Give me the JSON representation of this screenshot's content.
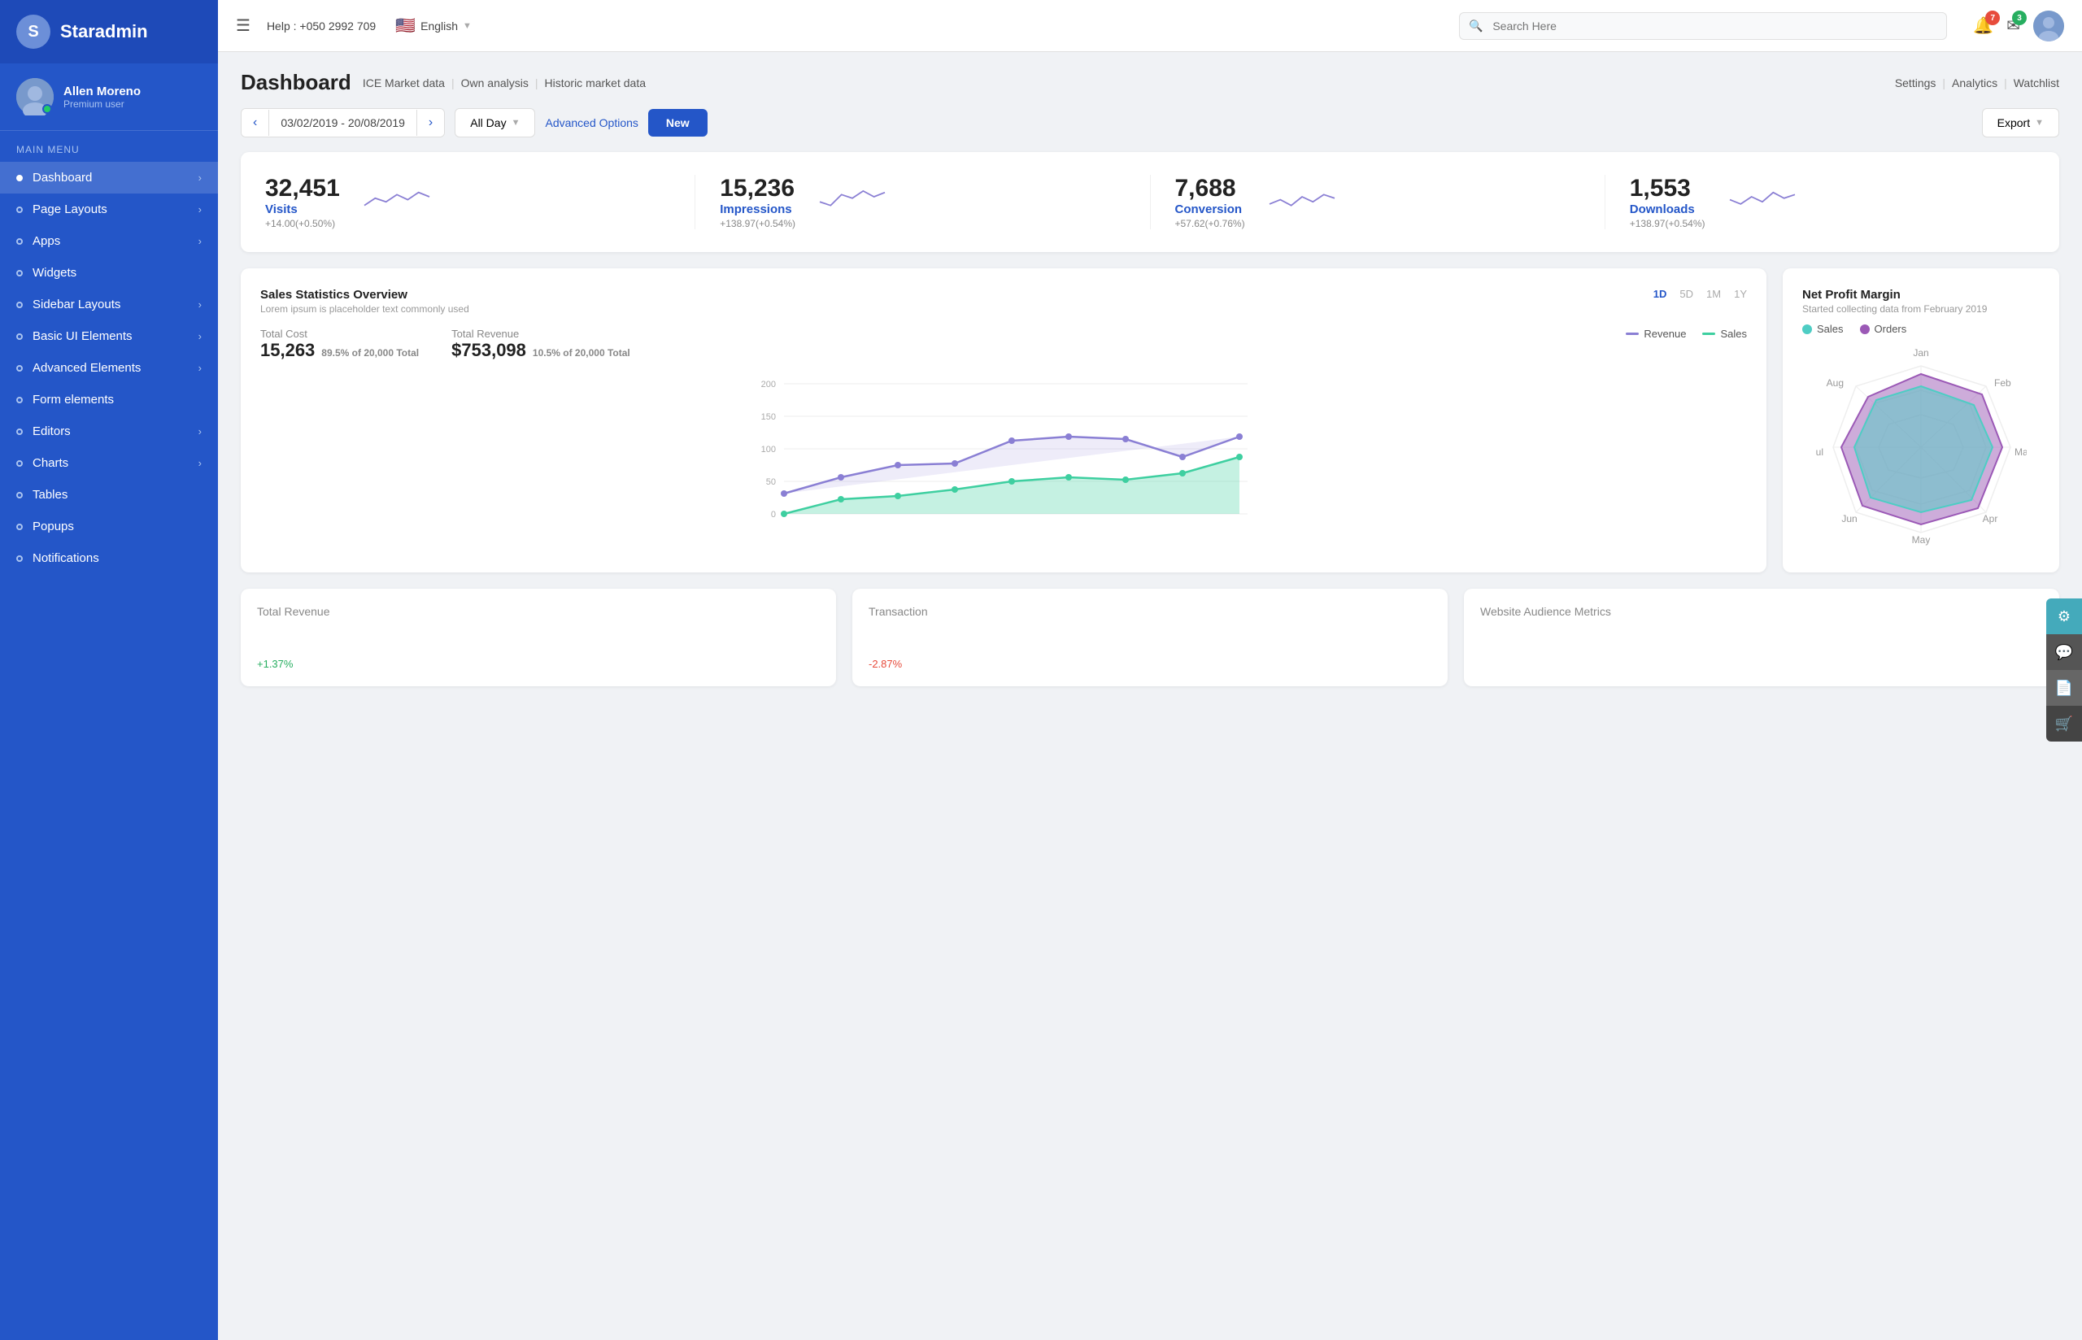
{
  "sidebar": {
    "logo_initial": "S",
    "logo_text": "Staradmin",
    "user_name": "Allen Moreno",
    "user_role": "Premium user",
    "main_menu_label": "Main Menu",
    "items": [
      {
        "label": "Dashboard",
        "has_arrow": true,
        "active": true
      },
      {
        "label": "Page Layouts",
        "has_arrow": true,
        "active": false
      },
      {
        "label": "Apps",
        "has_arrow": true,
        "active": false
      },
      {
        "label": "Widgets",
        "has_arrow": false,
        "active": false
      },
      {
        "label": "Sidebar Layouts",
        "has_arrow": true,
        "active": false
      },
      {
        "label": "Basic UI Elements",
        "has_arrow": true,
        "active": false
      },
      {
        "label": "Advanced Elements",
        "has_arrow": true,
        "active": false
      },
      {
        "label": "Form elements",
        "has_arrow": false,
        "active": false
      },
      {
        "label": "Editors",
        "has_arrow": true,
        "active": false
      },
      {
        "label": "Charts",
        "has_arrow": true,
        "active": false
      },
      {
        "label": "Tables",
        "has_arrow": false,
        "active": false
      },
      {
        "label": "Popups",
        "has_arrow": false,
        "active": false
      },
      {
        "label": "Notifications",
        "has_arrow": false,
        "active": false
      }
    ]
  },
  "topbar": {
    "help_text": "Help : +050 2992 709",
    "lang": "English",
    "search_placeholder": "Search Here",
    "notif_badge": "7",
    "mail_badge": "3"
  },
  "dashboard": {
    "title": "Dashboard",
    "nav_links": [
      "ICE Market data",
      "Own analysis",
      "Historic market data"
    ],
    "right_links": [
      "Settings",
      "Analytics",
      "Watchlist"
    ],
    "date_range": "03/02/2019 - 20/08/2019",
    "allday_label": "All Day",
    "advanced_options_label": "Advanced Options",
    "new_label": "New",
    "export_label": "Export"
  },
  "stats": [
    {
      "value": "32,451",
      "label": "Visits",
      "change": "+14.00(+0.50%)"
    },
    {
      "value": "15,236",
      "label": "Impressions",
      "change": "+138.97(+0.54%)"
    },
    {
      "value": "7,688",
      "label": "Conversion",
      "change": "+57.62(+0.76%)"
    },
    {
      "value": "1,553",
      "label": "Downloads",
      "change": "+138.97(+0.54%)"
    }
  ],
  "sales_chart": {
    "title": "Sales Statistics Overview",
    "subtitle": "Lorem ipsum is placeholder text commonly used",
    "tabs": [
      "1D",
      "5D",
      "1M",
      "1Y"
    ],
    "active_tab": "1D",
    "total_cost_label": "Total Cost",
    "total_cost_value": "15,263",
    "total_cost_pct": "89.5% of 20,000 Total",
    "total_revenue_label": "Total Revenue",
    "total_revenue_value": "$753,098",
    "total_revenue_pct": "10.5% of 20,000 Total",
    "legend_revenue": "Revenue",
    "legend_sales": "Sales"
  },
  "net_profit": {
    "title": "Net Profit Margin",
    "subtitle": "Started collecting data from February 2019",
    "legend_sales": "Sales",
    "legend_orders": "Orders",
    "months": [
      "Jan",
      "Feb",
      "Mar",
      "Apr",
      "May",
      "Jun",
      "Jul",
      "Aug"
    ]
  },
  "bottom_cards": [
    {
      "label": "Total Revenue",
      "value": "",
      "change": "+1.37%",
      "positive": true
    },
    {
      "label": "Transaction",
      "value": "",
      "change": "-2.87%",
      "positive": false
    },
    {
      "label": "Website Audience Metrics",
      "value": "",
      "change": "",
      "positive": true
    }
  ],
  "right_panel": {
    "buttons": [
      "⚙",
      "💬",
      "📄",
      "🛒"
    ]
  }
}
